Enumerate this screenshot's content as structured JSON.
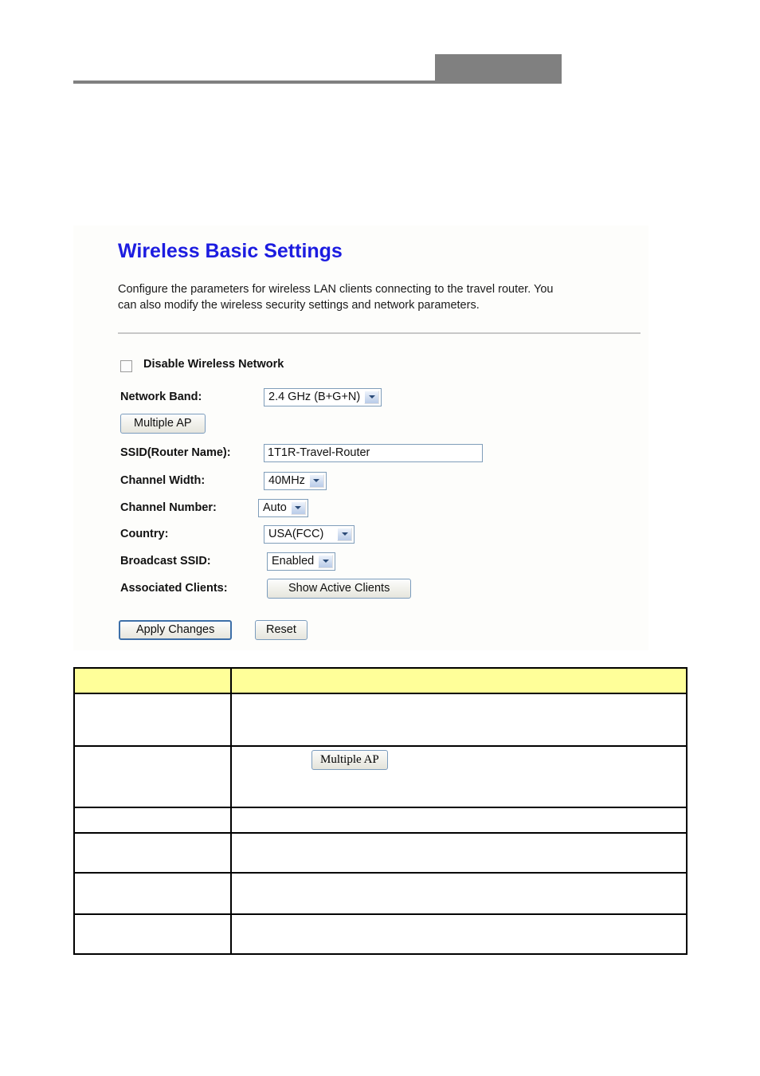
{
  "header": {
    "gray_block": "",
    "rule": ""
  },
  "panel": {
    "title": "Wireless Basic Settings",
    "description": "Configure the parameters for wireless LAN clients connecting to the travel router. You can also modify the wireless security settings and network parameters."
  },
  "form": {
    "disable_wireless": {
      "label": "Disable Wireless Network",
      "checked": false
    },
    "network_band": {
      "label": "Network Band:",
      "value": "2.4 GHz (B+G+N)"
    },
    "multiple_ap": {
      "label": "Multiple AP"
    },
    "ssid": {
      "label": "SSID(Router Name):",
      "value": "1T1R-Travel-Router"
    },
    "channel_width": {
      "label": "Channel Width:",
      "value": "40MHz"
    },
    "channel_number": {
      "label": "Channel Number:",
      "value": "Auto"
    },
    "country": {
      "label": "Country:",
      "value": "USA(FCC)"
    },
    "broadcast_ssid": {
      "label": "Broadcast SSID:",
      "value": "Enabled"
    },
    "associated_clients": {
      "label": "Associated Clients:",
      "button": "Show Active Clients"
    },
    "actions": {
      "apply": "Apply Changes",
      "reset": "Reset"
    }
  },
  "description_table": {
    "headers": [
      "",
      ""
    ],
    "rows": [
      {
        "term": "",
        "description": "",
        "button": null
      },
      {
        "term": "",
        "description": "",
        "button": "Multiple AP"
      },
      {
        "term": "",
        "description": "",
        "button": null
      },
      {
        "term": "",
        "description": "",
        "button": null
      },
      {
        "term": "",
        "description": "",
        "button": null
      },
      {
        "term": "",
        "description": "",
        "button": null
      }
    ]
  },
  "colors": {
    "title_blue": "#1c1ce0",
    "table_header_yellow": "#ffff99",
    "header_gray": "#808080",
    "field_border_blue": "#7f9db9"
  }
}
